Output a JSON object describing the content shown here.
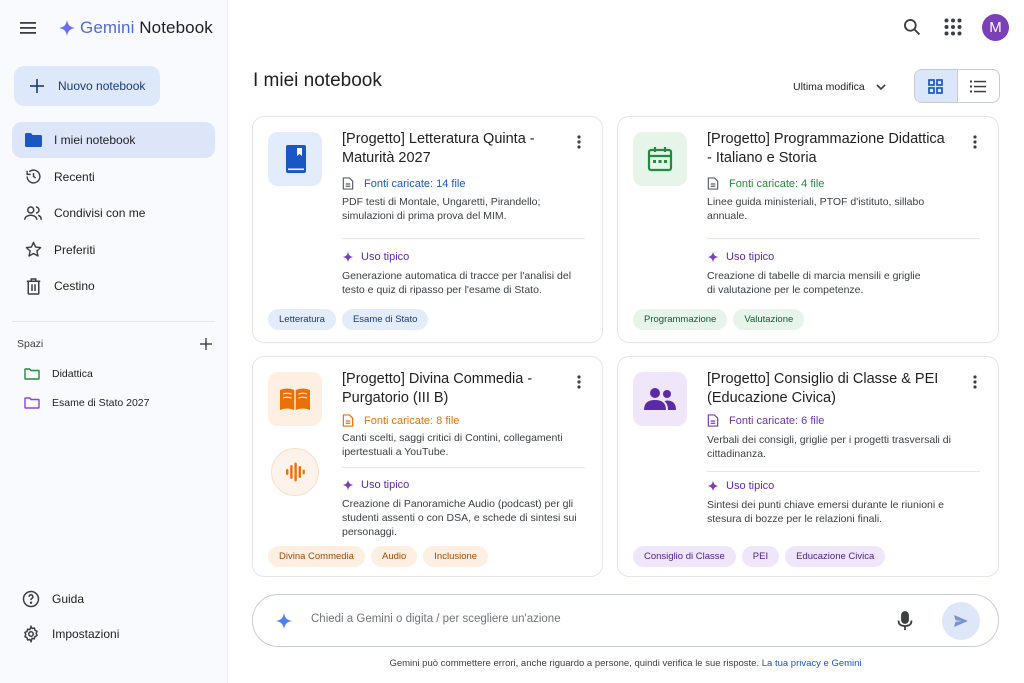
{
  "app": {
    "name_brand": "Gemini",
    "name_product": " Notebook"
  },
  "sidebar": {
    "new_notebook": "Nuovo notebook",
    "nav": [
      {
        "label": "I miei notebook",
        "icon": "folder-icon",
        "active": true
      },
      {
        "label": "Recenti",
        "icon": "history-icon"
      },
      {
        "label": "Condivisi con me",
        "icon": "people-icon"
      },
      {
        "label": "Preferiti",
        "icon": "star-icon"
      },
      {
        "label": "Cestino",
        "icon": "trash-icon"
      }
    ],
    "spaces_label": "Spazi",
    "spaces": [
      {
        "label": "Didattica",
        "color": "#1e8e3e"
      },
      {
        "label": "Esame di Stato 2027",
        "color": "#8e44d6"
      }
    ],
    "help": "Guida",
    "settings": "Impostazioni"
  },
  "header": {
    "avatar_letter": "M",
    "avatar_color": "#7b3fb6"
  },
  "main": {
    "title": "I miei notebook",
    "sort_label": "Ultima modifica"
  },
  "cards": [
    {
      "title": "[Progetto] Letteratura Quinta - Maturità 2027",
      "icon": "book-icon",
      "accent": "#1a56c4",
      "sources": "Fonti caricate: 14 file",
      "description": "PDF testi di Montale, Ungaretti, Pirandello; simulazioni di prima prova del MIM.",
      "usage_label": "Uso tipico",
      "usage": "Generazione automatica di tracce per l'analisi del testo e quiz di ripasso per l'esame di Stato.",
      "tags": [
        "Letteratura",
        "Esame di Stato"
      ]
    },
    {
      "title": "[Progetto] Programmazione Didattica - Italiano e Storia",
      "icon": "calendar-icon",
      "accent": "#1e8e3e",
      "sources": "Fonti caricate: 4 file",
      "description": "Linee guida ministeriali, PTOF d'istituto, sillabo annuale.",
      "usage_label": "Uso tipico",
      "usage": "Creazione di tabelle di marcia mensili e griglie di valutazione per le competenze.",
      "tags": [
        "Programmazione",
        "Valutazione"
      ]
    },
    {
      "title": "[Progetto] Divina Commedia - Purgatorio (III B)",
      "icon": "open-book-icon",
      "accent": "#e8710a",
      "sources": "Fonti caricate: 8 file",
      "description": "Canti scelti, saggi critici di Contini, collegamenti ipertestuali a YouTube.",
      "usage_label": "Uso tipico",
      "usage": "Creazione di Panoramiche Audio (podcast) per gli studenti assenti o con DSA, e schede di sintesi sui personaggi.",
      "tags": [
        "Divina Commedia",
        "Audio",
        "Inclusione"
      ]
    },
    {
      "title": "[Progetto] Consiglio di Classe & PEI (Educazione Civica)",
      "icon": "group-icon",
      "accent": "#7b3fb6",
      "sources": "Fonti caricate: 6 file",
      "description": "Verbali dei consigli, griglie per i progetti trasversali di cittadinanza.",
      "usage_label": "Uso tipico",
      "usage": "Sintesi dei punti chiave emersi durante le riunioni e stesura di bozze per le relazioni finali.",
      "tags": [
        "Consiglio di Classe",
        "PEI",
        "Educazione Civica"
      ]
    }
  ],
  "composer": {
    "placeholder": "Chiedi a Gemini o digita / per scegliere un'azione"
  },
  "footer": {
    "disclaimer": "Gemini può commettere errori, anche riguardo a persone, quindi verifica le sue risposte. ",
    "link": "La tua privacy e Gemini"
  }
}
